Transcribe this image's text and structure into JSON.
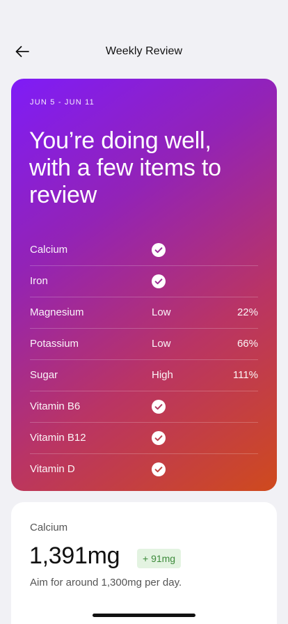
{
  "nav": {
    "title": "Weekly Review",
    "back_icon": "arrow-left-icon"
  },
  "hero": {
    "date_range": "JUN 5 - JUN 11",
    "headline": "You’re doing well, with a few items to review",
    "gradient_colors": [
      "#7f1cf7",
      "#9323b6",
      "#b93465",
      "#cf4a1d"
    ],
    "nutrients": [
      {
        "name": "Calcium",
        "ok": true,
        "status": "",
        "percent": ""
      },
      {
        "name": "Iron",
        "ok": true,
        "status": "",
        "percent": ""
      },
      {
        "name": "Magnesium",
        "ok": false,
        "status": "Low",
        "percent": "22%"
      },
      {
        "name": "Potassium",
        "ok": false,
        "status": "Low",
        "percent": "66%"
      },
      {
        "name": "Sugar",
        "ok": false,
        "status": "High",
        "percent": "111%"
      },
      {
        "name": "Vitamin B6",
        "ok": true,
        "status": "",
        "percent": ""
      },
      {
        "name": "Vitamin B12",
        "ok": true,
        "status": "",
        "percent": ""
      },
      {
        "name": "Vitamin D",
        "ok": true,
        "status": "",
        "percent": ""
      }
    ],
    "check_icon": "checkmark-circle-icon"
  },
  "detail": {
    "label": "Calcium",
    "amount": "1,391mg",
    "delta": "+ 91mg",
    "note": "Aim for around 1,300mg per day.",
    "badge_bg": "#e3f3e1",
    "badge_color": "#3c8a3a"
  }
}
